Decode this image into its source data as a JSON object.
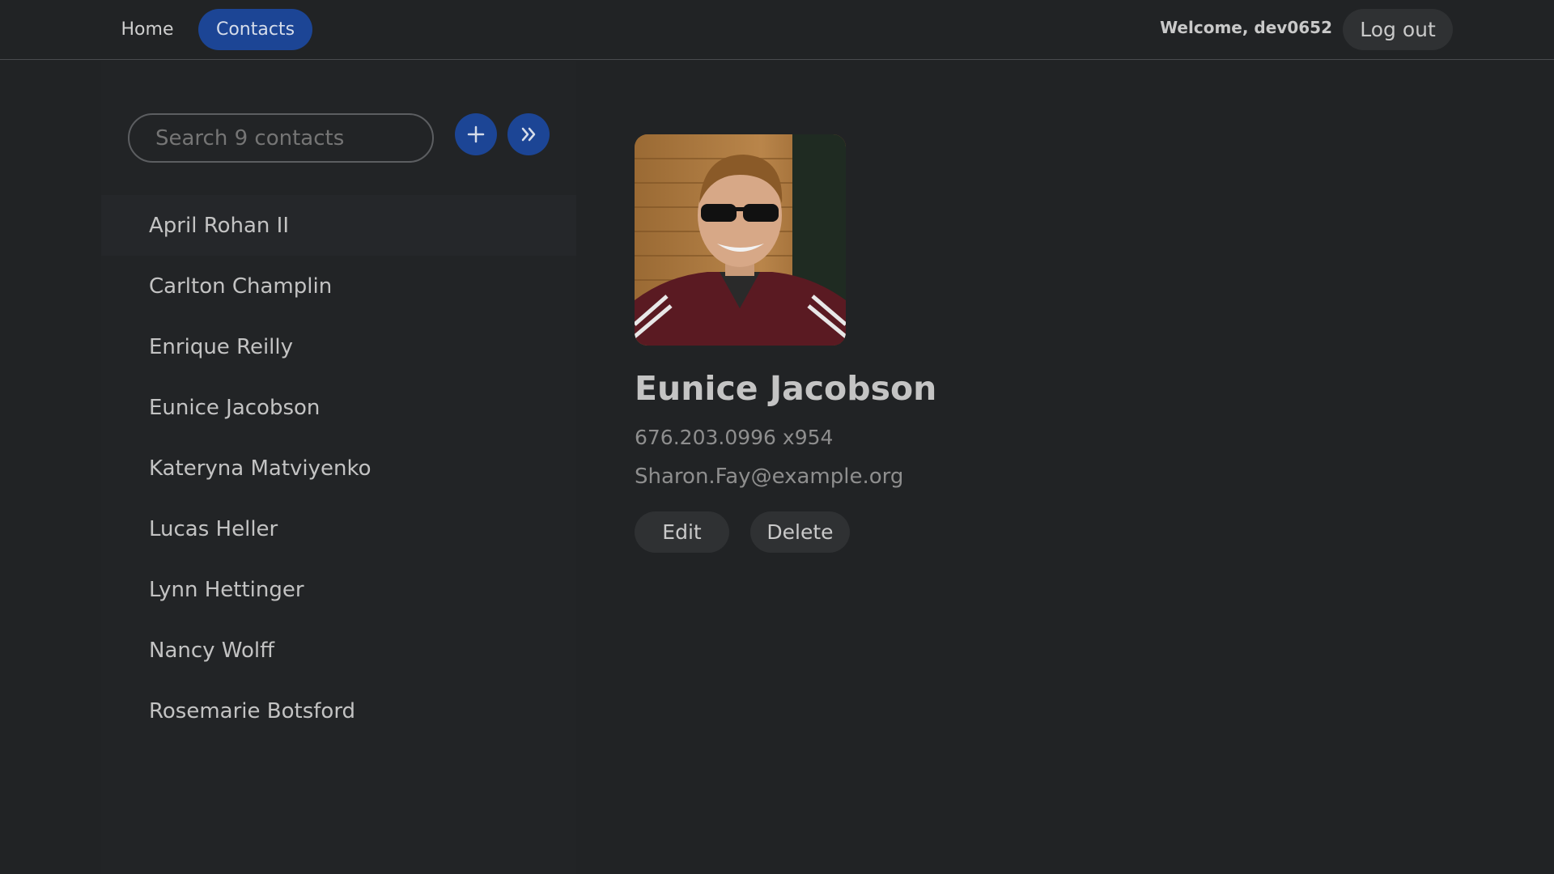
{
  "nav": {
    "home_label": "Home",
    "contacts_label": "Contacts"
  },
  "user": {
    "welcome_text": "Welcome, dev0652",
    "logout_label": "Log out"
  },
  "sidebar": {
    "search_placeholder": "Search 9 contacts",
    "add_icon": "plus-icon",
    "expand_icon": "double-chevron-right-icon",
    "contacts": [
      "April Rohan II",
      "Carlton Champlin",
      "Enrique Reilly",
      "Eunice Jacobson",
      "Kateryna Matviyenko",
      "Lucas Heller",
      "Lynn Hettinger",
      "Nancy Wolff",
      "Rosemarie Botsford"
    ]
  },
  "detail": {
    "name": "Eunice Jacobson",
    "phone": "676.203.0996 x954",
    "email": "Sharon.Fay@example.org",
    "edit_label": "Edit",
    "delete_label": "Delete"
  },
  "colors": {
    "accent": "#1c4595",
    "background": "#212325",
    "button_bg": "#2f3133"
  }
}
